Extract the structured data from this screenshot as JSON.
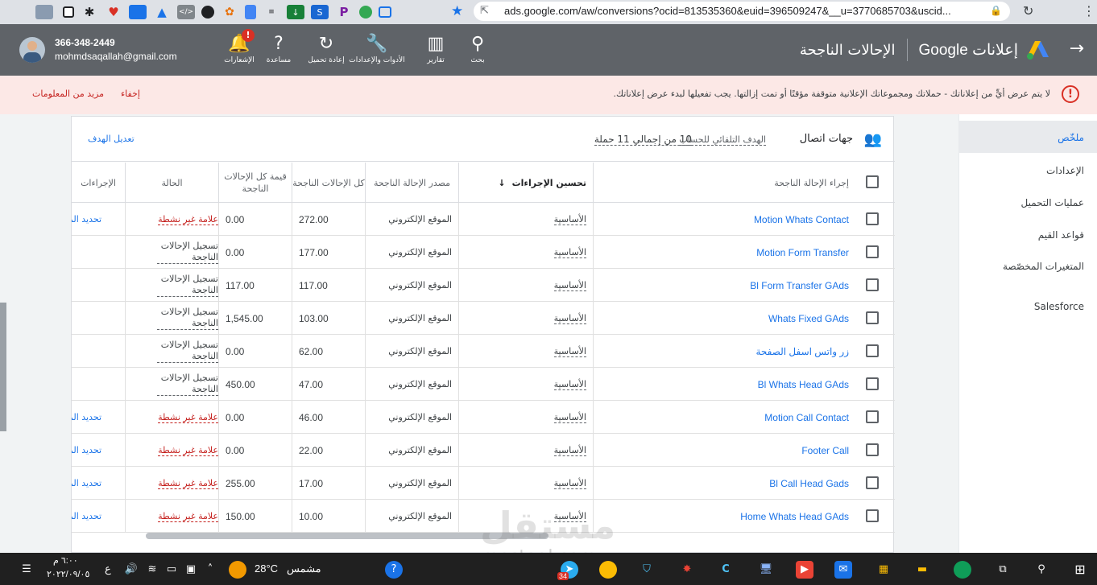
{
  "browser": {
    "url": "ads.google.com/aw/conversions?ocid=813535360&euid=396509247&__u=3770685703&uscid..."
  },
  "header": {
    "phone": "366-348-2449",
    "email": "mohmdsaqallah@gmail.com",
    "buttons": [
      {
        "label": "الإشعارات",
        "icon": "bell-icon"
      },
      {
        "label": "مساعدة",
        "icon": "help-icon"
      },
      {
        "label": "إعادة تحميل",
        "icon": "refresh-icon"
      },
      {
        "label": "الأدوات والإعدادات",
        "icon": "wrench-icon"
      },
      {
        "label": "تقارير",
        "icon": "chart-icon"
      },
      {
        "label": "بحث",
        "icon": "search-icon"
      }
    ],
    "notif_badge": "!",
    "product": "إعلانات Google",
    "page_title": "الإحالات الناجحة"
  },
  "banner": {
    "message": "لا يتم عرض أيٍّ من إعلاناتك - حملاتك ومجموعاتك الإعلانية متوقفة مؤقتًا أو تمت إزالتها. يجب تفعيلها لبدء عرض إعلاناتك.",
    "hide": "إخفاء",
    "more": "مزيد من المعلومات"
  },
  "sidenav": {
    "items": [
      "ملخّص",
      "الإعدادات",
      "عمليات التحميل",
      "قواعد القيم",
      "المتغيرات المخصّصة",
      "Salesforce"
    ]
  },
  "goal": {
    "name": "جهات اتصال",
    "type": "الهدف التلقائي للحساب",
    "count": "10 من إجمالي 11 حملة",
    "edit": "تعديل الهدف"
  },
  "table": {
    "headers": {
      "name": "إجراء الإحالة الناجحة",
      "optimization": "تحسين الإجراءات",
      "source": "مصدر الإحالة الناجحة",
      "all_conv": "كل الإحالات الناجحة",
      "all_value": "قيمة كل الإحالات الناجحة",
      "status": "الحالة",
      "actions": "الإجراءات"
    },
    "rows": [
      {
        "name": "Motion Whats Contact",
        "optimization": "الأساسية",
        "source": "الموقع الإلكتروني",
        "all_conv": "272.00",
        "all_value": "0.00",
        "status": "علامة غير نشطة",
        "status_type": "inactive",
        "action": "تحديد المش"
      },
      {
        "name": "Motion Form Transfer",
        "optimization": "الأساسية",
        "source": "الموقع الإلكتروني",
        "all_conv": "177.00",
        "all_value": "0.00",
        "status": "تسجيل الإحالات الناجحة",
        "status_type": "recording",
        "action": ""
      },
      {
        "name": "Bl Form Transfer GAds",
        "optimization": "الأساسية",
        "source": "الموقع الإلكتروني",
        "all_conv": "117.00",
        "all_value": "117.00",
        "status": "تسجيل الإحالات الناجحة",
        "status_type": "recording",
        "action": ""
      },
      {
        "name": "Whats Fixed GAds",
        "optimization": "الأساسية",
        "source": "الموقع الإلكتروني",
        "all_conv": "103.00",
        "all_value": "1,545.00",
        "status": "تسجيل الإحالات الناجحة",
        "status_type": "recording",
        "action": ""
      },
      {
        "name": "زر واتس اسفل الصفحة",
        "optimization": "الأساسية",
        "source": "الموقع الإلكتروني",
        "all_conv": "62.00",
        "all_value": "0.00",
        "status": "تسجيل الإحالات الناجحة",
        "status_type": "recording",
        "action": ""
      },
      {
        "name": "Bl Whats Head GAds",
        "optimization": "الأساسية",
        "source": "الموقع الإلكتروني",
        "all_conv": "47.00",
        "all_value": "450.00",
        "status": "تسجيل الإحالات الناجحة",
        "status_type": "recording",
        "action": ""
      },
      {
        "name": "Motion Call Contact",
        "optimization": "الأساسية",
        "source": "الموقع الإلكتروني",
        "all_conv": "46.00",
        "all_value": "0.00",
        "status": "علامة غير نشطة",
        "status_type": "inactive",
        "action": "تحديد المش"
      },
      {
        "name": "Footer Call",
        "optimization": "الأساسية",
        "source": "الموقع الإلكتروني",
        "all_conv": "22.00",
        "all_value": "0.00",
        "status": "علامة غير نشطة",
        "status_type": "inactive",
        "action": "تحديد المش"
      },
      {
        "name": "Bl Call Head Gads",
        "optimization": "الأساسية",
        "source": "الموقع الإلكتروني",
        "all_conv": "17.00",
        "all_value": "255.00",
        "status": "علامة غير نشطة",
        "status_type": "inactive",
        "action": "تحديد المش"
      },
      {
        "name": "Home Whats Head GAds",
        "optimization": "الأساسية",
        "source": "الموقع الإلكتروني",
        "all_conv": "10.00",
        "all_value": "150.00",
        "status": "علامة غير نشطة",
        "status_type": "inactive",
        "action": "تحديد المش"
      }
    ]
  },
  "watermark": {
    "top": "مستقل",
    "bottom": "mostaql.com"
  },
  "taskbar": {
    "time": "٦:٠٠ م",
    "date": "٢٠٢٢/٠٩/٠٥",
    "lang": "ع",
    "weather_temp": "28°C",
    "weather_text": "مشمس",
    "telegram_badge": "34"
  },
  "colors": {
    "header": "#5f6368",
    "banner": "#fce8e6",
    "link": "#1a73e8",
    "error": "#c5221f"
  }
}
